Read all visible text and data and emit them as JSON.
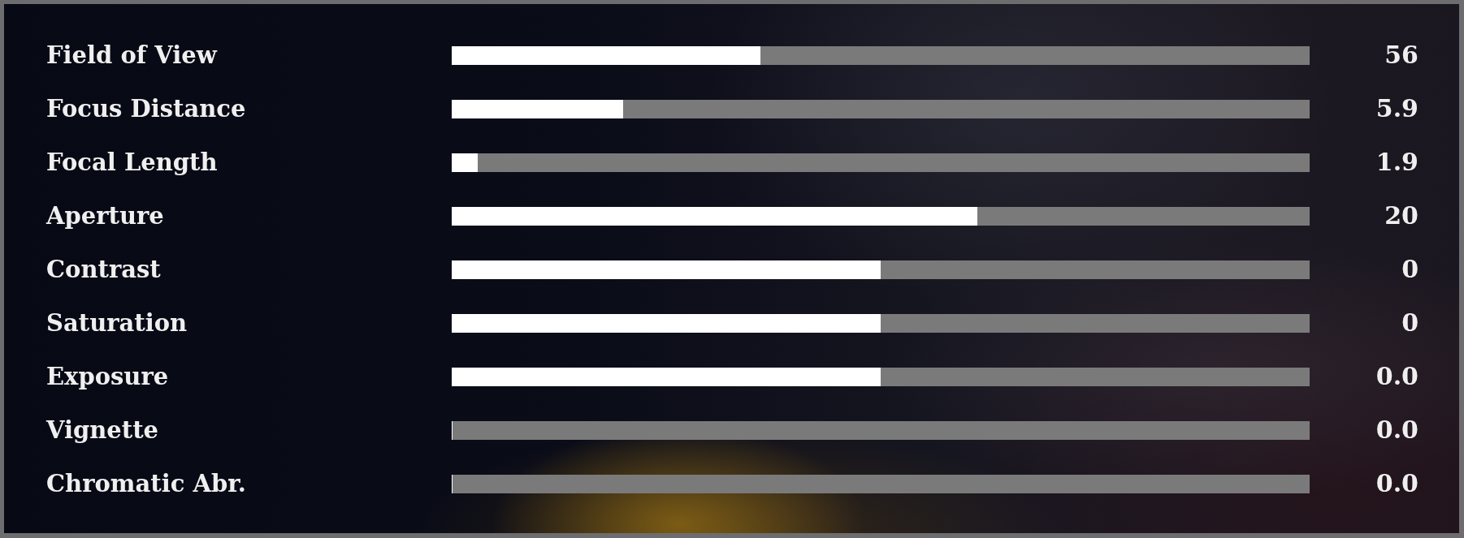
{
  "settings": [
    {
      "label": "Field of View",
      "level": 0.36,
      "value": "56"
    },
    {
      "label": "Focus Distance",
      "level": 0.2,
      "value": "5.9"
    },
    {
      "label": "Focal Length",
      "level": 0.03,
      "value": "1.9"
    },
    {
      "label": "Aperture",
      "level": 0.613,
      "value": "20"
    },
    {
      "label": "Contrast",
      "level": 0.5,
      "value": "0"
    },
    {
      "label": "Saturation",
      "level": 0.5,
      "value": "0"
    },
    {
      "label": "Exposure",
      "level": 0.5,
      "value": "0.0"
    },
    {
      "label": "Vignette",
      "level": 0,
      "value": "0.0"
    },
    {
      "label": "Chromatic Abr.",
      "level": 0,
      "value": "0.0"
    }
  ]
}
